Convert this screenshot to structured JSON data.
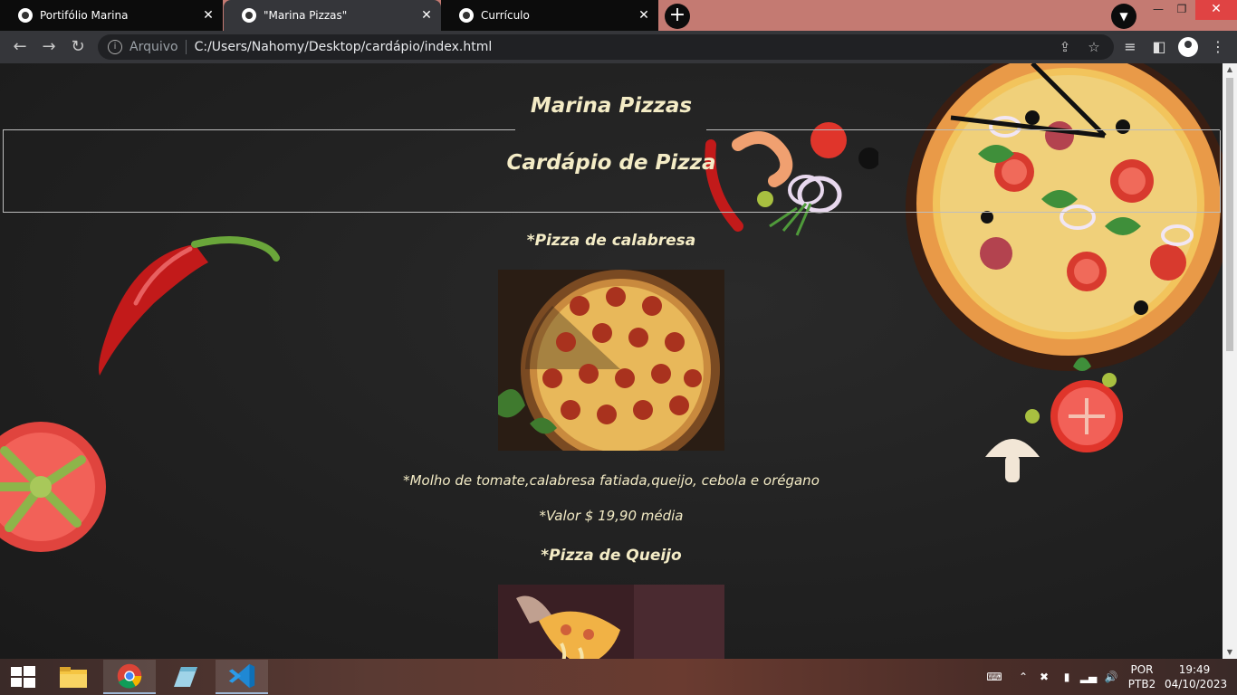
{
  "browser": {
    "tabs": [
      {
        "title": "Portifólio Marina",
        "active": false
      },
      {
        "title": "\"Marina Pizzas\"",
        "active": true
      },
      {
        "title": "Currículo",
        "active": false
      }
    ],
    "address": {
      "scheme_label": "Arquivo",
      "url": "C:/Users/Nahomy/Desktop/cardápio/index.html"
    }
  },
  "page": {
    "site_title": "Marina Pizzas",
    "menu_heading": "Cardápio de Pizza",
    "items": [
      {
        "name": "*Pizza de calabresa",
        "description": "*Molho de tomate,calabresa fatiada,queijo, cebola e orégano",
        "price": "*Valor $ 19,90 média"
      },
      {
        "name": "*Pizza de Queijo"
      }
    ],
    "text_color": "#f4ecc6",
    "background_color": "#202020"
  },
  "taskbar": {
    "apps": [
      "windows-start",
      "file-explorer",
      "chrome",
      "notepad",
      "vscode"
    ],
    "language": {
      "line1": "POR",
      "line2": "PTB2"
    },
    "clock": {
      "time": "19:49",
      "date": "04/10/2023"
    }
  }
}
